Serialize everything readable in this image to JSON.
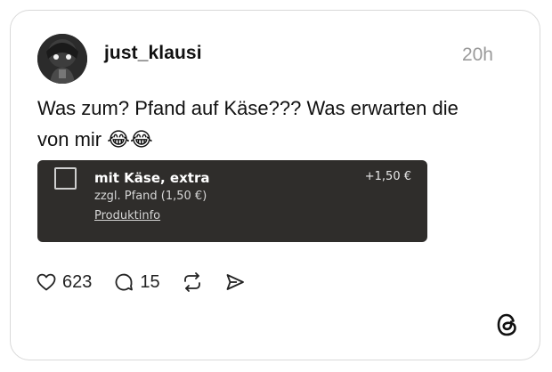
{
  "post": {
    "username": "just_klausi",
    "timestamp": "20h",
    "text": "Was zum? Pfand auf Käse??? Was erwarten die von mir 😂😂"
  },
  "product_card": {
    "name": "mit Käse, extra",
    "deposit": "zzgl. Pfand (1,50 €)",
    "info_link": "Produktinfo",
    "price": "+1,50 €"
  },
  "actions": {
    "likes": "623",
    "replies": "15"
  },
  "icons": [
    "heart-icon",
    "reply-icon",
    "repost-icon",
    "share-icon",
    "threads-logo-icon"
  ],
  "colors": {
    "card_border": "#d9d9d9",
    "timestamp": "#9a9a9a",
    "product_bg": "#2f2d2b"
  }
}
